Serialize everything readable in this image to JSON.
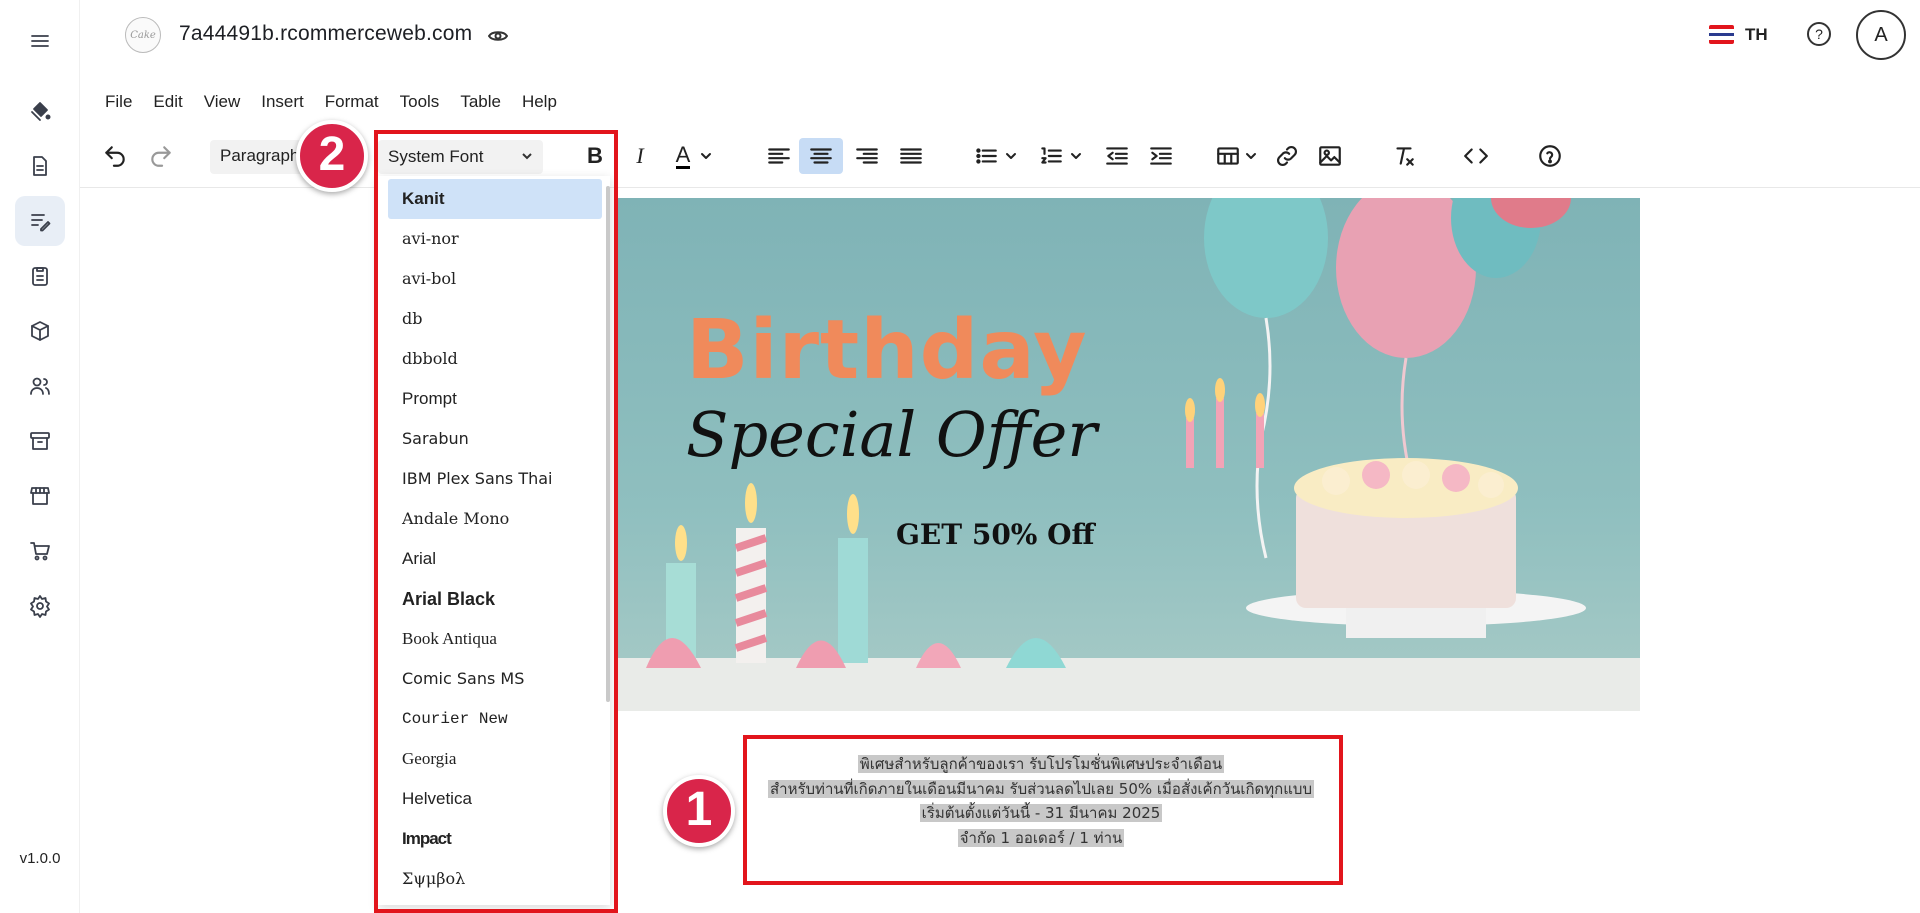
{
  "app": {
    "site_name": "7a44491b.rcommerceweb.com",
    "language": "TH",
    "avatar_initial": "A",
    "version": "v1.0.0",
    "logo_text": "Cake"
  },
  "sidebar": {
    "items": [
      {
        "icon": "menu-icon"
      },
      {
        "icon": "paint-bucket-icon"
      },
      {
        "icon": "document-icon"
      },
      {
        "icon": "edit-lines-icon",
        "active": true
      },
      {
        "icon": "clipboard-icon"
      },
      {
        "icon": "box-icon"
      },
      {
        "icon": "users-icon"
      },
      {
        "icon": "archive-icon"
      },
      {
        "icon": "store-icon"
      },
      {
        "icon": "cart-icon"
      },
      {
        "icon": "settings-icon"
      }
    ]
  },
  "menubar": [
    "File",
    "Edit",
    "View",
    "Insert",
    "Format",
    "Tools",
    "Table",
    "Help"
  ],
  "toolbar": {
    "block_format": "Paragraph",
    "font_family": "System Font",
    "bold": "B",
    "italic": "I",
    "text_color": "A"
  },
  "font_dropdown": {
    "items": [
      "Kanit",
      "avi-nor",
      "avi-bol",
      "db",
      "dbbold",
      "Prompt",
      "Sarabun",
      "IBM Plex Sans Thai",
      "Andale Mono",
      "Arial",
      "Arial Black",
      "Book Antiqua",
      "Comic Sans MS",
      "Courier New",
      "Georgia",
      "Helvetica",
      "Impact",
      "Σψμβολ"
    ],
    "selected": "Kanit"
  },
  "banner": {
    "title": "Birthday",
    "subtitle": "Special Offer",
    "offer": "GET 50% Off"
  },
  "content": {
    "lines": [
      "พิเศษสำหรับลูกค้าของเรา รับโปรโมชั่นพิเศษประจำเดือน",
      "สำหรับท่านที่เกิดภายในเดือนมีนาคม รับส่วนลดไปเลย 50% เมื่อสั่งเค้กวันเกิดทุกแบบ",
      "เริ่มต้นตั้งแต่วันนี้ - 31 มีนาคม 2025",
      "จำกัด 1 ออเดอร์ / 1 ท่าน"
    ]
  },
  "badges": {
    "one": "1",
    "two": "2"
  },
  "colors": {
    "accent_red": "#e2151c",
    "badge": "#d9254a",
    "selected_bg": "#cfe2f8",
    "active_align": "#c7dcf5"
  }
}
